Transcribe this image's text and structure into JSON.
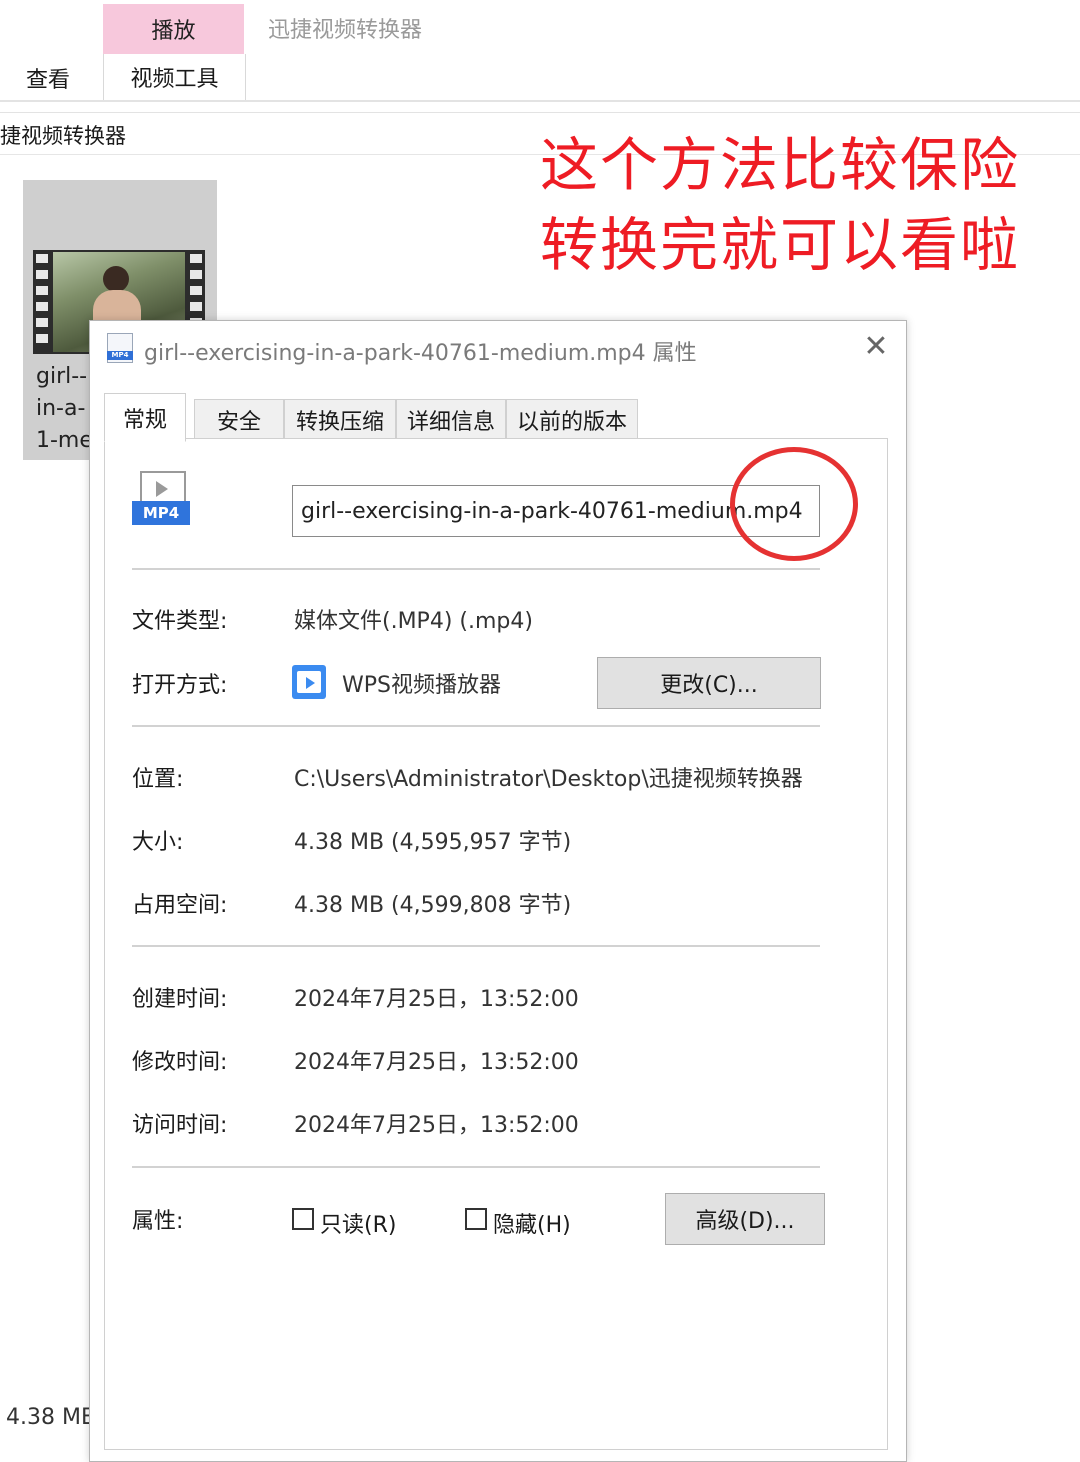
{
  "ribbon": {
    "tab_play": "播放",
    "tab_video_tools": "视频工具",
    "tab_view": "查看",
    "window_title": "迅捷视频转换器",
    "address_path": "捷视频转换器"
  },
  "annotation": {
    "line1": "这个方法比较保险",
    "line2": "转换完就可以看啦",
    "color": "#ee1c24"
  },
  "file_tile": {
    "name_lines": [
      "girl--",
      "in-a-",
      "1-me"
    ],
    "status_size": "4.38 ME"
  },
  "dialog": {
    "title": "girl--exercising-in-a-park-40761-medium.mp4 属性",
    "title_icon_badge": "MP4",
    "close_glyph": "✕",
    "tabs": [
      {
        "label": "常规",
        "active": true
      },
      {
        "label": "安全",
        "active": false
      },
      {
        "label": "转换压缩",
        "active": false
      },
      {
        "label": "详细信息",
        "active": false
      },
      {
        "label": "以前的版本",
        "active": false
      }
    ],
    "file_icon_tag": "MP4",
    "file_name": "girl--exercising-in-a-park-40761-medium.mp4",
    "file_type": {
      "label": "文件类型:",
      "value": "媒体文件(.MP4) (.mp4)"
    },
    "open_with": {
      "label": "打开方式:",
      "value": "WPS视频播放器",
      "button": "更改(C)..."
    },
    "location": {
      "label": "位置:",
      "value": "C:\\Users\\Administrator\\Desktop\\迅捷视频转换器"
    },
    "size": {
      "label": "大小:",
      "value": "4.38 MB (4,595,957 字节)"
    },
    "size_on_disk": {
      "label": "占用空间:",
      "value": "4.38 MB (4,599,808 字节)"
    },
    "created": {
      "label": "创建时间:",
      "value": "2024年7月25日，13:52:00"
    },
    "modified": {
      "label": "修改时间:",
      "value": "2024年7月25日，13:52:00"
    },
    "accessed": {
      "label": "访问时间:",
      "value": "2024年7月25日，13:52:00"
    },
    "attributes": {
      "label": "属性:",
      "readonly": "只读(R)",
      "hidden": "隐藏(H)",
      "advanced_button": "高级(D)..."
    }
  },
  "colors": {
    "ribbon_play_tab": "#f7c8dc",
    "highlight_circle": "#e53232"
  }
}
